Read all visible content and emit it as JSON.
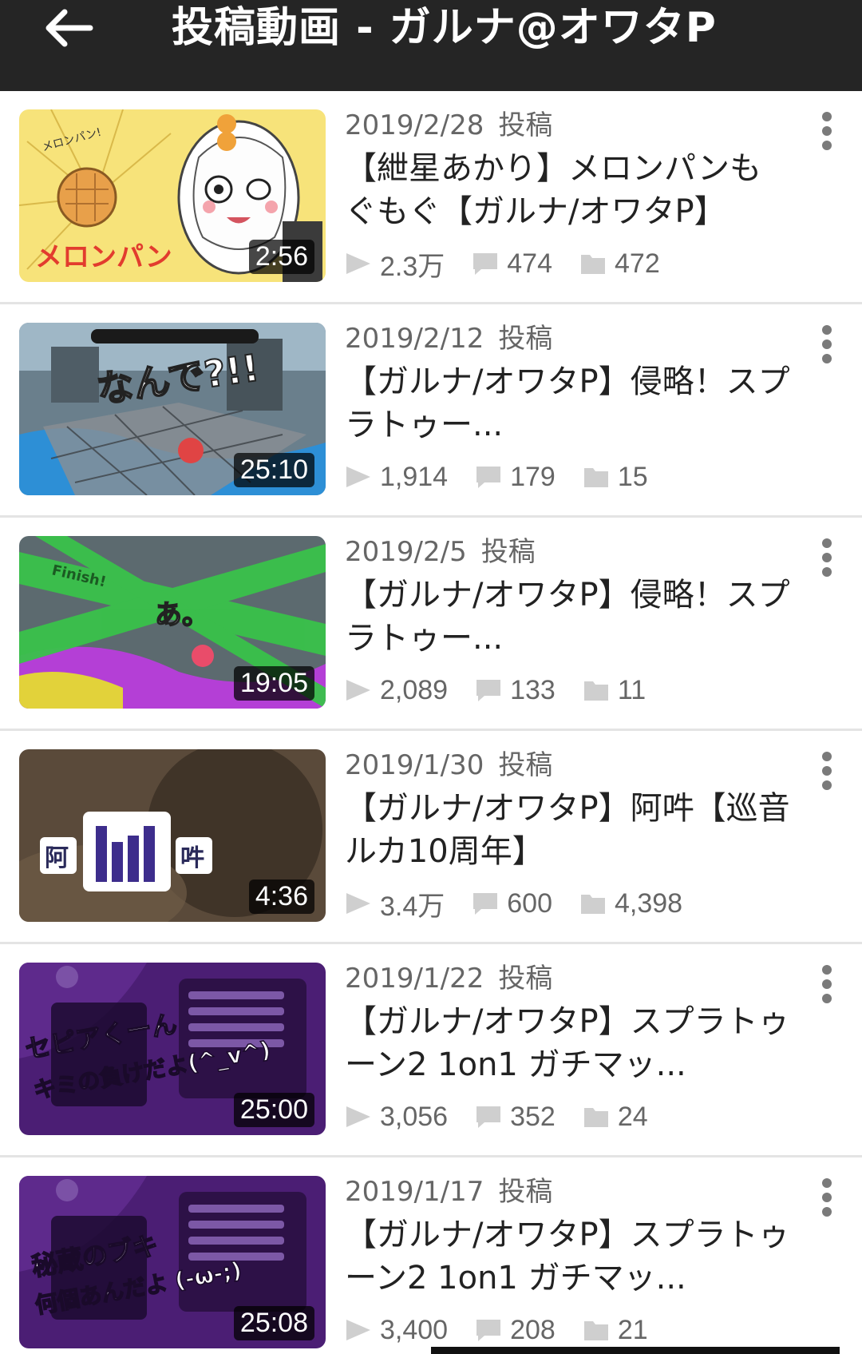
{
  "header": {
    "title": "投稿動画 - ガルナ@オワタP",
    "back_icon": "arrow-left-icon"
  },
  "labels": {
    "posted": "投稿"
  },
  "videos": [
    {
      "date": "2019/2/28",
      "title": "【紲星あかり】メロンパンもぐもぐ【ガルナ/オワタP】",
      "duration": "2:56",
      "views": "2.3万",
      "comments": "474",
      "mylists": "472",
      "thumb_text": "メロンパン",
      "thumb_subtext": "メロンパン!"
    },
    {
      "date": "2019/2/12",
      "title": "【ガルナ/オワタP】侵略！スプラトゥー...",
      "duration": "25:10",
      "views": "1,914",
      "comments": "179",
      "mylists": "15",
      "thumb_text": "なんで?!!"
    },
    {
      "date": "2019/2/5",
      "title": "【ガルナ/オワタP】侵略！スプラトゥー...",
      "duration": "19:05",
      "views": "2,089",
      "comments": "133",
      "mylists": "11",
      "thumb_text": "あ。",
      "thumb_subtext": "Finish!"
    },
    {
      "date": "2019/1/30",
      "title": "【ガルナ/オワタP】阿吽【巡音ルカ10周年】",
      "duration": "4:36",
      "views": "3.4万",
      "comments": "600",
      "mylists": "4,398",
      "thumb_text": "阿",
      "thumb_subtext": "吽"
    },
    {
      "date": "2019/1/22",
      "title": "【ガルナ/オワタP】スプラトゥーン2 1on1 ガチマッ...",
      "duration": "25:00",
      "views": "3,056",
      "comments": "352",
      "mylists": "24",
      "thumb_text": "セピアくーん",
      "thumb_subtext": "キミの負けだよ(^_v^)"
    },
    {
      "date": "2019/1/17",
      "title": "【ガルナ/オワタP】スプラトゥーン2 1on1 ガチマッ...",
      "duration": "25:08",
      "views": "3,400",
      "comments": "208",
      "mylists": "21",
      "thumb_text": "秘蔵のブキ",
      "thumb_subtext": "何個あんだよ (-ω-;)"
    }
  ],
  "icons": {
    "views": "play-icon",
    "comments": "comment-icon",
    "mylists": "folder-icon",
    "more": "more-vert-icon"
  },
  "colors": {
    "header_bg": "#252525",
    "meta_text": "#666666",
    "title_text": "#222222",
    "divider": "#e4e4e4"
  }
}
